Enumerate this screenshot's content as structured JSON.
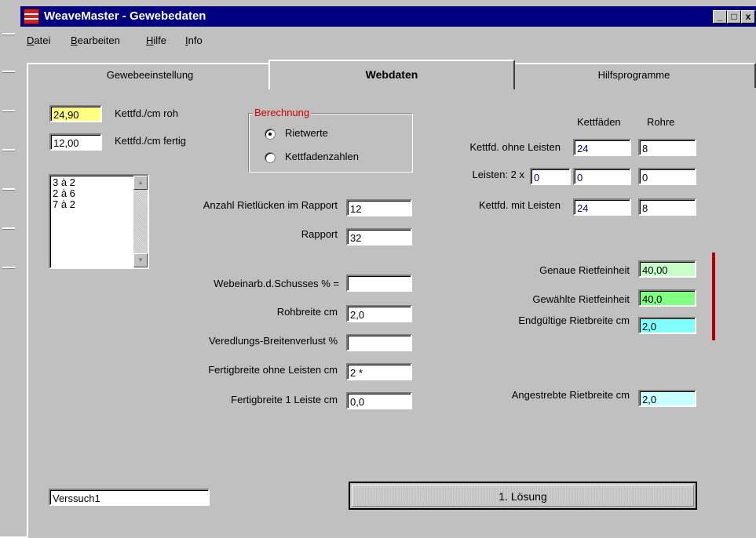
{
  "window": {
    "title": "WeaveMaster - Gewebedaten",
    "btn_min": "_",
    "btn_max": "□",
    "btn_close": "x"
  },
  "menu": [
    {
      "label_u": "D",
      "label_rest": "atei"
    },
    {
      "label_u": "B",
      "label_rest": "earbeiten"
    },
    {
      "label_u": "H",
      "label_rest": "ilfe"
    },
    {
      "label_u": "I",
      "label_rest": "nfo"
    }
  ],
  "tabs": [
    "Gewebeeinstellung",
    "Webdaten",
    "Hilfsprogramme"
  ],
  "active_tab": "Webdaten",
  "top_left": {
    "roh_value": "24,90",
    "roh_label": "Kettfd./cm roh",
    "fertig_value": "12,00",
    "fertig_label": "Kettfd./cm fertig"
  },
  "berechnung": {
    "legend": "Berechnung",
    "options": [
      "Rietwerte",
      "Kettfadenzahlen"
    ],
    "selected": "Rietwerte"
  },
  "list_items": [
    "3 à 2",
    "2 à 6",
    "7 à 2"
  ],
  "middle": {
    "anzahl_label": "Anzahl Rietlücken im Rapport",
    "anzahl_value": "12",
    "rapport_label": "Rapport",
    "rapport_value": "32",
    "webeinarb_label": "Webeinarb.d.Schusses % =",
    "webeinarb_value": "",
    "rohbreite_label": "Rohbreite cm",
    "rohbreite_value": "2,0",
    "veredlung_label": "Veredlungs-Breitenverlust %",
    "veredlung_value": "",
    "fertig_ohne_label": "Fertigbreite ohne Leisten cm",
    "fertig_ohne_value": "2 *",
    "fertig_leiste_label": "Fertigbreite 1 Leiste cm",
    "fertig_leiste_value": "0,0"
  },
  "right_table": {
    "col_kettfaeden": "Kettfäden",
    "col_rohre": "Rohre",
    "row1_label": "Kettfd. ohne Leisten",
    "row1_kett": "24",
    "row1_rohre": "8",
    "row2_label": "Leisten: 2 x",
    "row2_factor": "0",
    "row2_kett": "0",
    "row2_rohre": "0",
    "row3_label": "Kettfd. mit Leisten",
    "row3_kett": "24",
    "row3_rohre": "8"
  },
  "riet": {
    "genau_label": "Genaue Rietfeinheit",
    "genau_value": "40,00",
    "gewaehlt_label": "Gewählte Rietfeinheit",
    "gewaehlt_value": "40,0",
    "endg_label": "Endgültige Rietbreite cm",
    "endg_value": "2,0",
    "angestrebt_label": "Angestrebte Rietbreite cm",
    "angestrebt_value": "2,0"
  },
  "colors": {
    "yellow": "#ffff80",
    "lightgreen": "#c8ffc8",
    "green": "#80ff80",
    "cyan": "#80ffff",
    "lightcyan": "#c8ffff",
    "red_bar": "#b00000"
  },
  "bottom": {
    "name_value": "Verssuch1",
    "solve_button": "1. Lösung"
  }
}
